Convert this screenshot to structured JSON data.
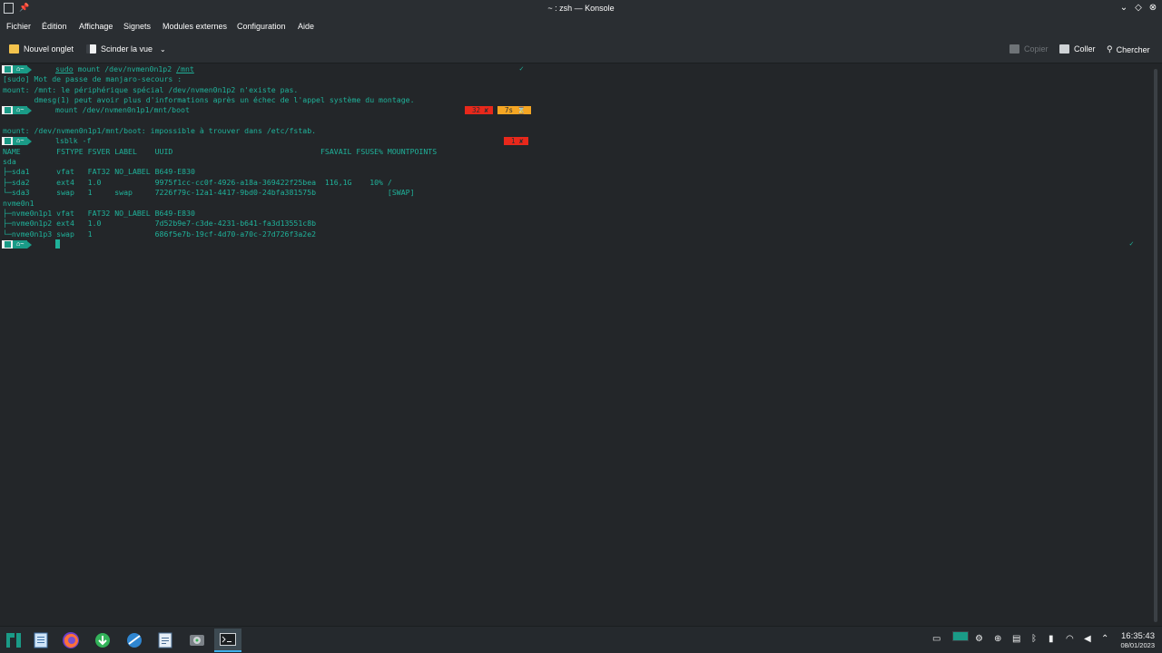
{
  "window": {
    "title": "~ : zsh — Konsole",
    "controls": {
      "minimize": "⌄",
      "maximize": "◇",
      "close": "⊗"
    }
  },
  "menu": [
    "Fichier",
    "Édition",
    "Affichage",
    "Signets",
    "Modules externes",
    "Configuration",
    "Aide"
  ],
  "toolbar": {
    "new_tab": "Nouvel onglet",
    "split_view": "Scinder la vue",
    "copy": "Copier",
    "paste": "Coller",
    "search": "Chercher"
  },
  "prompt": {
    "home_symbol": "~"
  },
  "terminal": {
    "cmd1": {
      "sudo": "sudo",
      "mid": " mount /dev/nvmen0n1p2 ",
      "path": "/mnt"
    },
    "out1": [
      "[sudo] Mot de passe de manjaro-secours :",
      "mount: /mnt: le périphérique spécial /dev/nvmen0n1p2 n'existe pas.",
      "       dmesg(1) peut avoir plus d'informations après un échec de l'appel système du montage."
    ],
    "cmd2": "mount /dev/nvmen0n1p1/mnt/boot",
    "cmd2_status": {
      "code": "32 ✘",
      "time": "7s ⌛"
    },
    "out2": "mount: /dev/nvmen0n1p1/mnt/boot: impossible à trouver dans /etc/fstab.",
    "cmd3": "lsblk -f",
    "cmd3_status": {
      "code": "1 ✘"
    },
    "lsblk": [
      "NAME        FSTYPE FSVER LABEL    UUID                                 FSAVAIL FSUSE% MOUNTPOINTS",
      "sda",
      "├─sda1      vfat   FAT32 NO_LABEL B649-E830",
      "├─sda2      ext4   1.0            9975f1cc-cc0f-4926-a18a-369422f25bea  116,1G    10% /",
      "└─sda3      swap   1     swap     7226f79c-12a1-4417-9bd0-24bfa381575b                [SWAP]",
      "nvme0n1",
      "├─nvme0n1p1 vfat   FAT32 NO_LABEL B649-E830",
      "├─nvme0n1p2 ext4   1.0            7d52b9e7-c3de-4231-b641-fa3d13551c8b",
      "└─nvme0n1p3 swap   1              686f5e7b-19cf-4d70-a70c-27d726f3a2e2"
    ],
    "ok_mark": "✓"
  },
  "colors": {
    "terminal_text": "#1fb29a",
    "prompt_bg": "#1a9b87",
    "error_bg": "#e8281b",
    "time_bg": "#f5a623",
    "background": "#232629"
  },
  "clock": {
    "time": "16:35:43",
    "date": "08/01/2023"
  }
}
